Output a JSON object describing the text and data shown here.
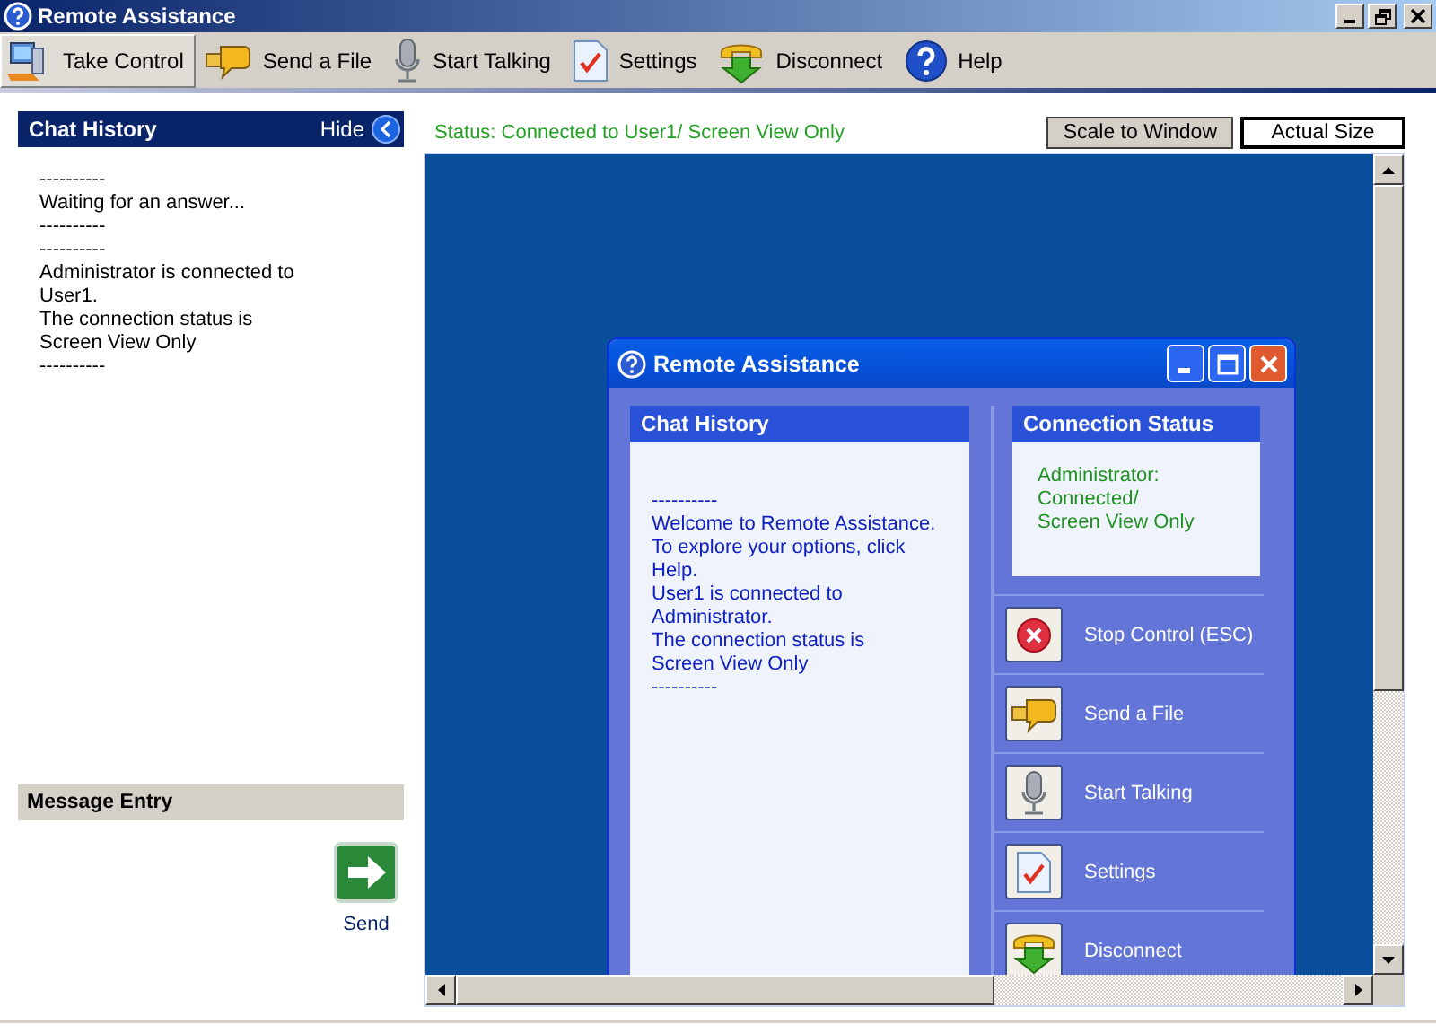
{
  "window": {
    "title": "Remote Assistance"
  },
  "toolbar": [
    {
      "label": "Take Control",
      "kind": "computer",
      "selected": true
    },
    {
      "label": "Send a File",
      "kind": "file",
      "selected": false
    },
    {
      "label": "Start Talking",
      "kind": "mic",
      "selected": false
    },
    {
      "label": "Settings",
      "kind": "settings",
      "selected": false
    },
    {
      "label": "Disconnect",
      "kind": "disconnect",
      "selected": false
    },
    {
      "label": "Help",
      "kind": "help",
      "selected": false
    }
  ],
  "chat_history": {
    "title": "Chat History",
    "hide_label": "Hide",
    "lines": [
      "----------",
      "Waiting for an answer...",
      "----------",
      "----------",
      "Administrator is connected to",
      "User1.",
      "The connection status is",
      "Screen View Only",
      "----------"
    ]
  },
  "message_entry": {
    "title": "Message Entry",
    "send_label": "Send"
  },
  "status": "Status: Connected to User1/ Screen View Only",
  "view_buttons": [
    {
      "label": "Scale to Window",
      "selected": false
    },
    {
      "label": "Actual Size",
      "selected": true
    }
  ],
  "remote_window": {
    "title": "Remote Assistance",
    "chat_history": {
      "title": "Chat History",
      "lines": [
        "----------",
        "Welcome to Remote Assistance.",
        "To explore your options, click",
        "Help.",
        "User1 is connected to",
        "Administrator.",
        "The connection status is",
        "Screen View Only",
        "----------"
      ]
    },
    "connection_status": {
      "title": "Connection Status",
      "lines": [
        "Administrator:",
        "Connected/",
        "Screen View Only"
      ]
    },
    "actions": [
      {
        "label": "Stop Control (ESC)",
        "kind": "stop"
      },
      {
        "label": "Send a File",
        "kind": "file"
      },
      {
        "label": "Start Talking",
        "kind": "mic"
      },
      {
        "label": "Settings",
        "kind": "settings"
      },
      {
        "label": "Disconnect",
        "kind": "disconnect"
      }
    ]
  }
}
